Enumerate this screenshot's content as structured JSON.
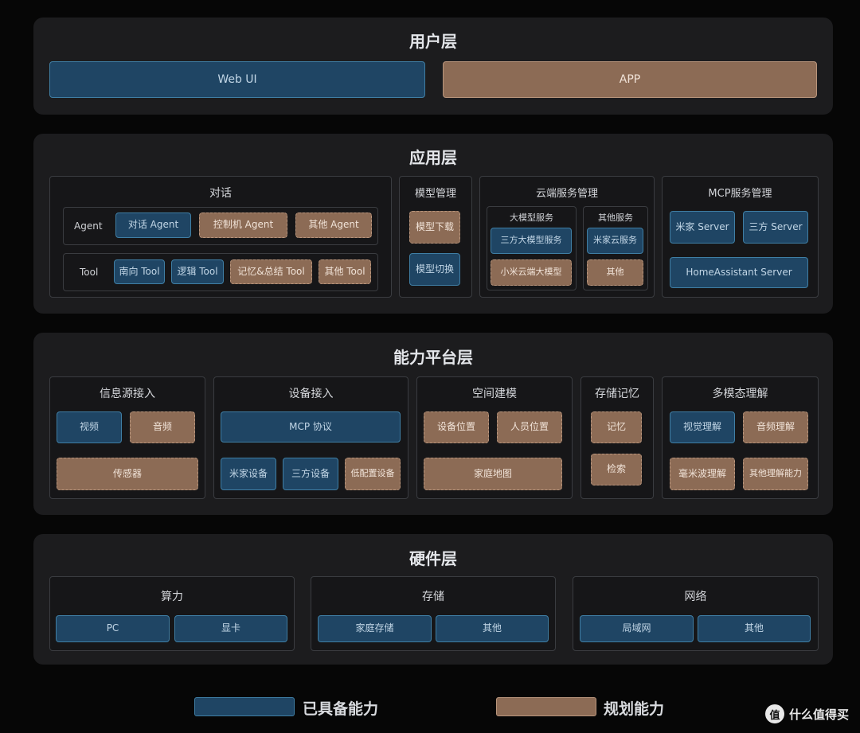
{
  "colors": {
    "existing": "#1f4564",
    "planned": "#8c6b55",
    "layer_bg": "#1c1c1e",
    "page_bg": "#060606"
  },
  "user_layer": {
    "title": "用户层",
    "web_ui": "Web UI",
    "app": "APP"
  },
  "app_layer": {
    "title": "应用层",
    "dialog": {
      "title": "对话",
      "agent_label": "Agent",
      "agents": [
        "对话 Agent",
        "控制机 Agent",
        "其他 Agent"
      ],
      "tool_label": "Tool",
      "tools": [
        "南向 Tool",
        "逻辑 Tool",
        "记忆&总结 Tool",
        "其他 Tool"
      ]
    },
    "model_mgmt": {
      "title": "模型管理",
      "items": [
        "模型下载",
        "模型切换"
      ]
    },
    "cloud_mgmt": {
      "title": "云端服务管理",
      "large_model": {
        "title": "大模型服务",
        "items": [
          "三方大模型服务",
          "小米云端大模型"
        ]
      },
      "other_services": {
        "title": "其他服务",
        "items": [
          "米家云服务",
          "其他"
        ]
      }
    },
    "mcp_mgmt": {
      "title": "MCP服务管理",
      "items": [
        "米家 Server",
        "三方 Server",
        "HomeAssistant Server"
      ]
    }
  },
  "platform_layer": {
    "title": "能力平台层",
    "info_source": {
      "title": "信息源接入",
      "items": [
        "视频",
        "音频",
        "传感器"
      ]
    },
    "device_access": {
      "title": "设备接入",
      "items": [
        "MCP 协议",
        "米家设备",
        "三方设备",
        "低配置设备"
      ]
    },
    "space_modeling": {
      "title": "空间建模",
      "items": [
        "设备位置",
        "人员位置",
        "家庭地图"
      ]
    },
    "storage_memory": {
      "title": "存储记忆",
      "items": [
        "记忆",
        "检索"
      ]
    },
    "multimodal": {
      "title": "多模态理解",
      "items": [
        "视觉理解",
        "音频理解",
        "毫米波理解",
        "其他理解能力"
      ]
    }
  },
  "hardware_layer": {
    "title": "硬件层",
    "compute": {
      "title": "算力",
      "items": [
        "PC",
        "显卡"
      ]
    },
    "storage": {
      "title": "存储",
      "items": [
        "家庭存储",
        "其他"
      ]
    },
    "network": {
      "title": "网络",
      "items": [
        "局域网",
        "其他"
      ]
    }
  },
  "legend": {
    "existing": "已具备能力",
    "planned": "规划能力"
  },
  "watermark": {
    "icon": "值",
    "text": "什么值得买"
  }
}
